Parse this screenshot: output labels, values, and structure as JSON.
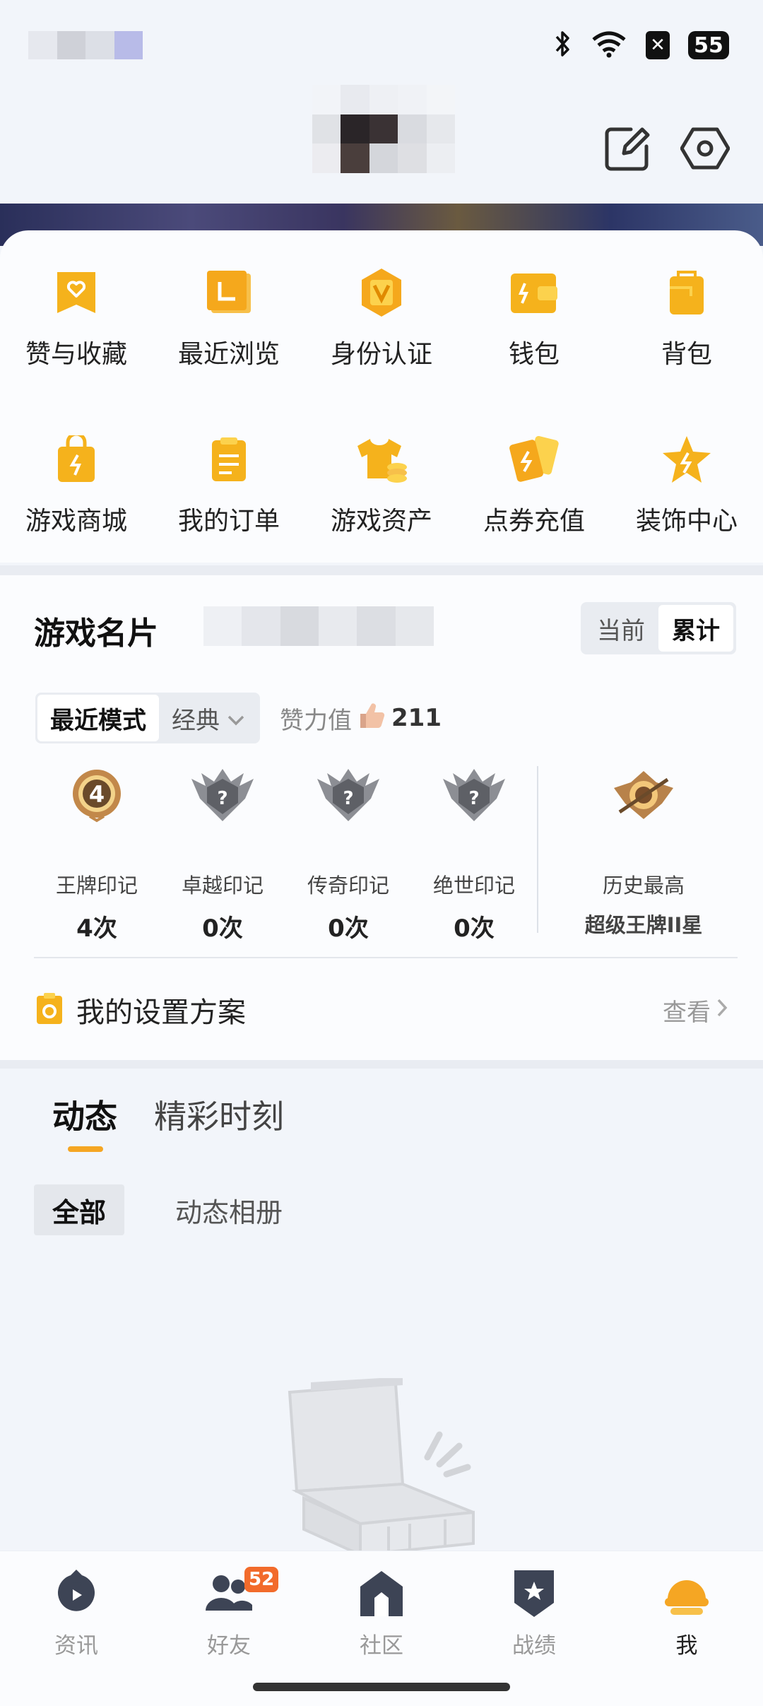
{
  "status": {
    "battery": "55",
    "blur_colors": [
      "#e6e8ee",
      "#cfd1d8",
      "#dcdfe6",
      "#b8bbe8"
    ]
  },
  "header": {
    "blur_colors": [
      "#f2f4f8",
      "#e8eaef",
      "#eef0f4",
      "#f0f2f6",
      "#f3f5f8",
      "#e0e2e6",
      "#2a2528",
      "#3a3234",
      "#d9dbe0",
      "#e6e8ec",
      "#ececf0",
      "#4a3e3c",
      "#d4d6db",
      "#dedfe3",
      "#eceef2"
    ]
  },
  "menu": {
    "items": [
      {
        "label": "赞与收藏",
        "icon": "heart-bookmark-icon"
      },
      {
        "label": "最近浏览",
        "icon": "recent-folder-icon"
      },
      {
        "label": "身份认证",
        "icon": "verified-v-icon"
      },
      {
        "label": "钱包",
        "icon": "wallet-icon"
      },
      {
        "label": "背包",
        "icon": "backpack-icon"
      },
      {
        "label": "游戏商城",
        "icon": "shopping-bag-icon"
      },
      {
        "label": "我的订单",
        "icon": "order-list-icon"
      },
      {
        "label": "游戏资产",
        "icon": "tshirt-coins-icon"
      },
      {
        "label": "点券充值",
        "icon": "voucher-cards-icon"
      },
      {
        "label": "装饰中心",
        "icon": "star-decoration-icon"
      }
    ]
  },
  "game_card": {
    "title": "游戏名片",
    "blur_colors": [
      "#eef0f4",
      "#e4e6eb",
      "#d8dadf",
      "#e8eaee",
      "#dcdee3",
      "#e6e8ec"
    ],
    "segment": {
      "current": "当前",
      "total": "累计"
    },
    "mode": {
      "recent": "最近模式",
      "classic": "经典"
    },
    "likes": {
      "label": "赞力值",
      "value": "211"
    },
    "marks": [
      {
        "name": "王牌印记",
        "count": "4次",
        "icon": "ace-mark-badge-icon"
      },
      {
        "name": "卓越印记",
        "count": "0次",
        "icon": "locked-mark-badge-icon"
      },
      {
        "name": "传奇印记",
        "count": "0次",
        "icon": "locked-mark-badge-icon"
      },
      {
        "name": "绝世印记",
        "count": "0次",
        "icon": "locked-mark-badge-icon"
      }
    ],
    "best": {
      "name": "历史最高",
      "value": "超级王牌II星",
      "icon": "super-ace-rank-icon"
    },
    "plan": {
      "title": "我的设置方案",
      "link": "查看"
    }
  },
  "feed": {
    "tabs": [
      "动态",
      "精彩时刻"
    ],
    "sub_tabs": [
      "全部",
      "动态相册"
    ]
  },
  "nav": {
    "items": [
      {
        "label": "资讯",
        "icon": "news-play-icon"
      },
      {
        "label": "好友",
        "icon": "friends-icon",
        "badge": "52"
      },
      {
        "label": "社区",
        "icon": "community-house-icon"
      },
      {
        "label": "战绩",
        "icon": "record-shield-icon"
      },
      {
        "label": "我",
        "icon": "me-helmet-icon"
      }
    ]
  },
  "colors": {
    "accent": "#f5a623",
    "badge": "#f26b2b"
  }
}
